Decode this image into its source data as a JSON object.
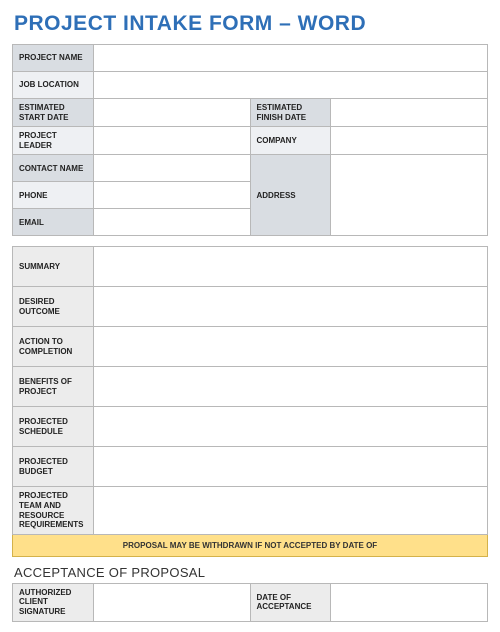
{
  "title": "PROJECT INTAKE FORM – WORD",
  "section1": {
    "project_name": {
      "label": "PROJECT NAME",
      "value": ""
    },
    "job_location": {
      "label": "JOB LOCATION",
      "value": ""
    },
    "est_start": {
      "label": "ESTIMATED START DATE",
      "value": ""
    },
    "est_finish": {
      "label": "ESTIMATED FINISH DATE",
      "value": ""
    },
    "project_leader": {
      "label": "PROJECT LEADER",
      "value": ""
    },
    "company": {
      "label": "COMPANY",
      "value": ""
    },
    "contact_name": {
      "label": "CONTACT NAME",
      "value": ""
    },
    "phone": {
      "label": "PHONE",
      "value": ""
    },
    "email": {
      "label": "EMAIL",
      "value": ""
    },
    "address": {
      "label": "ADDRESS",
      "value": ""
    }
  },
  "section2": [
    {
      "id": "summary",
      "label": "SUMMARY",
      "value": ""
    },
    {
      "id": "desired_outcome",
      "label": "DESIRED OUTCOME",
      "value": ""
    },
    {
      "id": "action_to_completion",
      "label": "ACTION TO COMPLETION",
      "value": ""
    },
    {
      "id": "benefits",
      "label": "BENEFITS OF PROJECT",
      "value": ""
    },
    {
      "id": "projected_schedule",
      "label": "PROJECTED SCHEDULE",
      "value": ""
    },
    {
      "id": "projected_budget",
      "label": "PROJECTED BUDGET",
      "value": ""
    },
    {
      "id": "projected_team",
      "label": "PROJECTED TEAM AND RESOURCE REQUIREMENTS",
      "value": ""
    }
  ],
  "notice": "PROPOSAL MAY BE WITHDRAWN IF NOT ACCEPTED BY DATE OF",
  "acceptance_heading": "ACCEPTANCE OF PROPOSAL",
  "section3": {
    "signature": {
      "label": "AUTHORIZED CLIENT SIGNATURE",
      "value": ""
    },
    "date": {
      "label": "DATE OF ACCEPTANCE",
      "value": ""
    }
  }
}
